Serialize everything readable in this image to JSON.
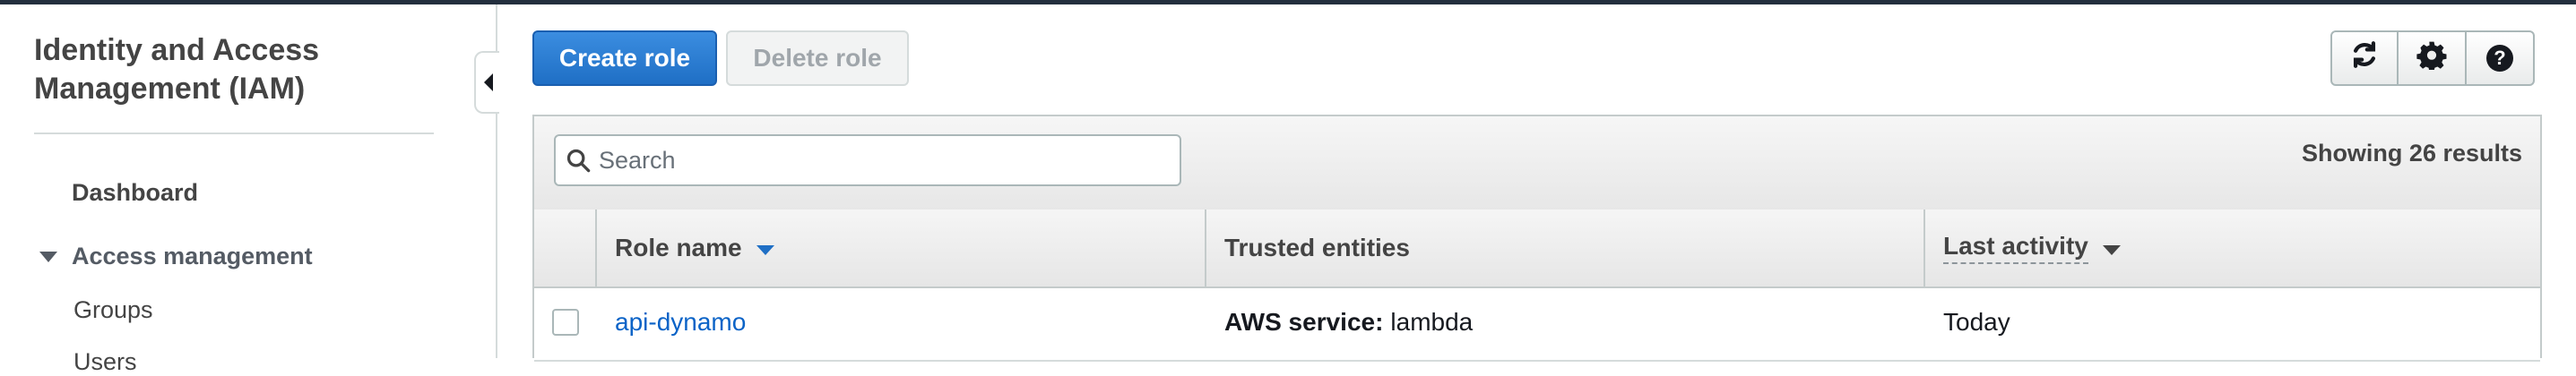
{
  "sidebar": {
    "title": "Identity and Access Management (IAM)",
    "dashboard": "Dashboard",
    "section": "Access management",
    "items": [
      "Groups",
      "Users"
    ]
  },
  "toolbar": {
    "create_label": "Create role",
    "delete_label": "Delete role",
    "icons": [
      "refresh-icon",
      "gear-icon",
      "help-icon"
    ]
  },
  "search": {
    "placeholder": "Search"
  },
  "results_text": "Showing 26 results",
  "table": {
    "columns": [
      "Role name",
      "Trusted entities",
      "Last activity"
    ],
    "rows": [
      {
        "role_name": "api-dynamo",
        "trusted_prefix": "AWS service:",
        "trusted_value": "lambda",
        "last_activity": "Today"
      }
    ]
  },
  "colors": {
    "primary": "#1f6fc5",
    "link": "#0b63c7",
    "topbar": "#232f3e"
  }
}
